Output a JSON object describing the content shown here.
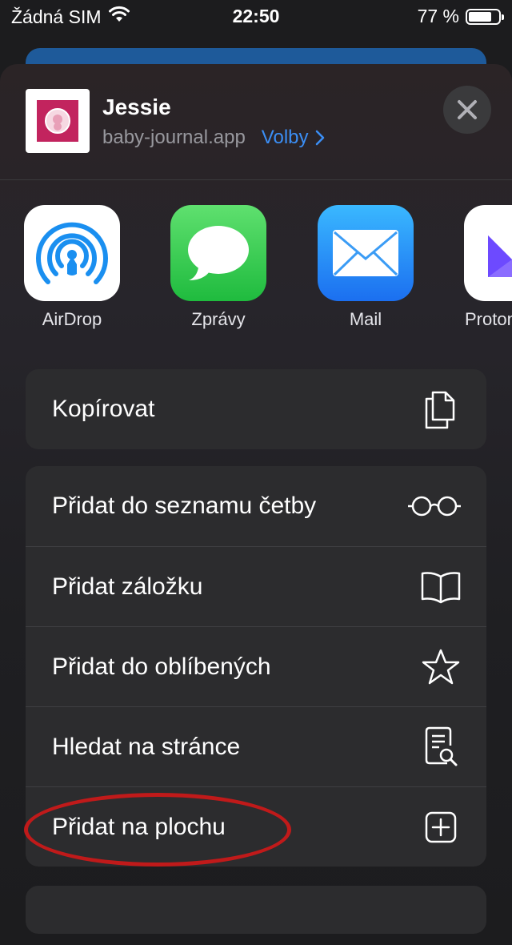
{
  "status_bar": {
    "carrier": "Žádná SIM",
    "time": "22:50",
    "battery_percent": "77 %",
    "battery_level": 0.77,
    "wifi_icon": "wifi-icon"
  },
  "share_header": {
    "title": "Jessie",
    "url": "baby-journal.app",
    "options_label": "Volby",
    "close_icon": "close-icon"
  },
  "apps": [
    {
      "label": "AirDrop",
      "icon": "airdrop-icon",
      "color": "#1a8ff0"
    },
    {
      "label": "Zprávy",
      "icon": "messages-icon",
      "color": "#34c759"
    },
    {
      "label": "Mail",
      "icon": "mail-icon",
      "color": "#1f8ff5"
    },
    {
      "label": "Proton",
      "icon": "proton-icon",
      "color": "#6d4aff"
    }
  ],
  "actions_group1": [
    {
      "label": "Kopírovat",
      "icon": "copy-icon"
    }
  ],
  "actions_group2": [
    {
      "label": "Přidat do seznamu četby",
      "icon": "glasses-icon"
    },
    {
      "label": "Přidat záložku",
      "icon": "book-icon"
    },
    {
      "label": "Přidat do oblíbených",
      "icon": "star-icon"
    },
    {
      "label": "Hledat na stránce",
      "icon": "find-on-page-icon"
    },
    {
      "label": "Přidat na plochu",
      "icon": "add-square-icon"
    }
  ],
  "colors": {
    "accent": "#3b8ef5",
    "highlight": "#c01a1a",
    "sheet": "#2c2c2e"
  }
}
